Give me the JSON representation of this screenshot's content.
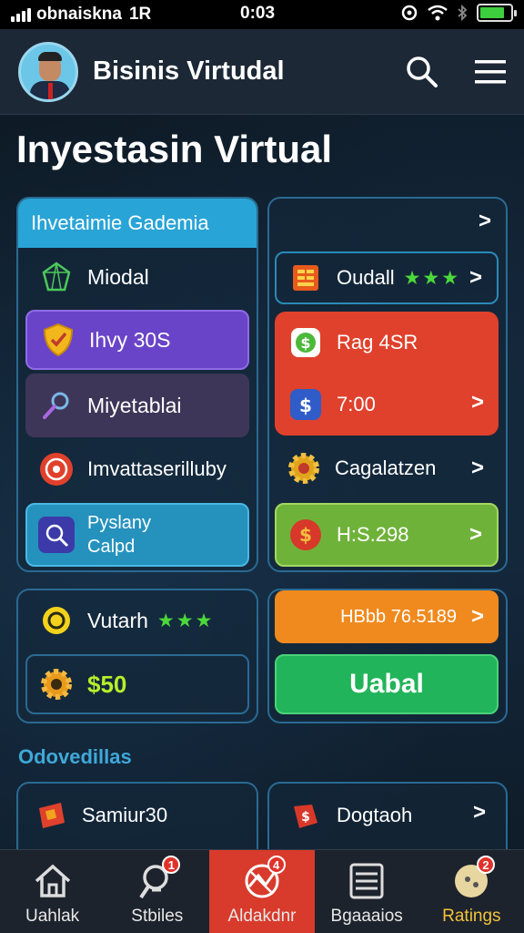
{
  "status": {
    "carrier": "obnaiskna",
    "network": "1R",
    "time": "0:03"
  },
  "header": {
    "title": "Bisinis Virtudal"
  },
  "page_title": "Inyestasin Virtual",
  "left_card": {
    "header": "Ihvetaimie Gademia",
    "items": [
      {
        "label": "Miodal",
        "icon": "gem-icon"
      },
      {
        "label": "Ihvy 30S",
        "icon": "shield-icon"
      },
      {
        "label": "Miyetablai",
        "icon": "magnifier-icon"
      },
      {
        "label": "Imvattaserilluby",
        "icon": "target-icon"
      },
      {
        "label": "Pyslany",
        "sublabel": "Calpd",
        "icon": "search-icon"
      }
    ]
  },
  "left_card2": {
    "items": [
      {
        "label": "Vutarh",
        "stars": "★★★",
        "icon": "coin-icon"
      },
      {
        "label": "$50",
        "icon": "gear-icon"
      }
    ]
  },
  "right_card": {
    "items": [
      {
        "label": "Oudall",
        "stars": "★★★",
        "icon": "book-icon"
      },
      {
        "label": "Rag 4SR",
        "icon": "money-icon"
      },
      {
        "label": "7:00",
        "icon": "dollar-shield-icon"
      },
      {
        "label": "Cagalatzen",
        "icon": "gear-money-icon"
      },
      {
        "label": "H:S.298",
        "icon": "money-bag-icon"
      }
    ]
  },
  "right_card2": {
    "items": [
      {
        "label": "HBbb 76.5189"
      },
      {
        "label": "Uabal"
      }
    ]
  },
  "section_title": "Odovedillas",
  "bottom_cards": [
    {
      "label": "Samiur30",
      "icon": "ticket-icon"
    },
    {
      "label": "Dogtaoh",
      "icon": "tag-icon"
    }
  ],
  "nav": [
    {
      "label": "Uahlak",
      "icon": "home-icon",
      "badge": ""
    },
    {
      "label": "Stbiles",
      "icon": "search-icon",
      "badge": "1"
    },
    {
      "label": "Aldakdnr",
      "icon": "chart-icon",
      "badge": "4"
    },
    {
      "label": "Bgaaaios",
      "icon": "list-icon",
      "badge": ""
    },
    {
      "label": "Ratings",
      "icon": "coin-icon",
      "badge": "2"
    }
  ],
  "colors": {
    "purple": "#6a44c8",
    "red": "#e0412c",
    "green": "#6fb23a",
    "orange": "#f08a1e",
    "bright_green": "#22b45a",
    "teal": "#24a0cc"
  }
}
